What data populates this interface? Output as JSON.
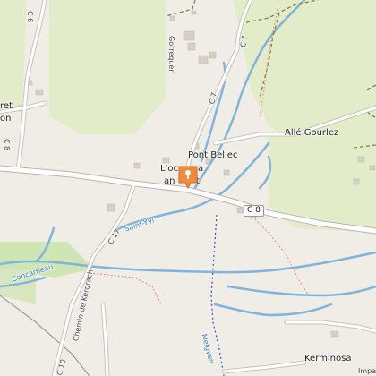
{
  "map": {
    "places": {
      "pont_bellec": "Pont Bellec",
      "alle_gourlez": "Allé Gourlez",
      "kerminosa": "Kerminosa",
      "gorrequer": "Gorrequer",
      "ocean_annant_part1": "L'oc",
      "ocean_annant_part2": "a",
      "ocean_annant_part3": "an",
      "ocean_annant_part4": "t",
      "left_edge_1": "ret",
      "left_edge_2": "on",
      "bottom_right_cut": "Impa"
    },
    "roads": {
      "c8_shield": "C 8",
      "c8_left": "C 8",
      "c6": "C 6",
      "c7_upper": "C 7",
      "c7_lower": "C 7",
      "c17": "C 17",
      "c10": "C 10",
      "chemin": "Chemin de Kergrach"
    },
    "water": {
      "saint_yvi": "Saint-Yvi",
      "concarneau": "Concarneau",
      "melgven": "Melgven"
    },
    "marker_icon": "map-pin-icon",
    "colors": {
      "background": "#f0ede6",
      "green_area": "#e3ecc8",
      "meadow": "#cfe5b4",
      "water": "#7fb4dd",
      "road": "#ffffff",
      "road_casing": "#b9b4ab",
      "marker": "#f08a3c"
    }
  }
}
